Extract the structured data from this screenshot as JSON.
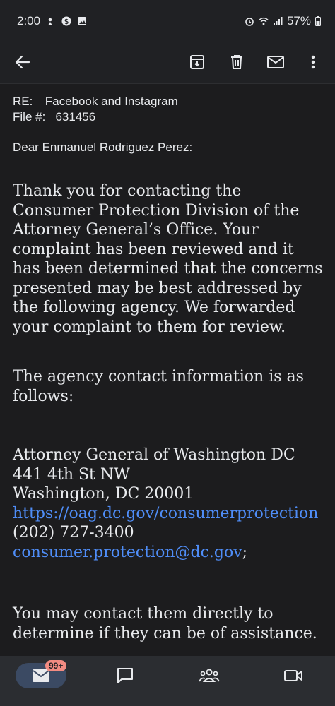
{
  "status_bar": {
    "time": "2:00",
    "battery": "57%",
    "icons": [
      "notification-icon",
      "s-app-icon",
      "image-icon",
      "alarm-icon",
      "wifi-icon",
      "signal-icon",
      "battery-icon"
    ]
  },
  "toolbar": {
    "icons": [
      "back-arrow-icon",
      "archive-icon",
      "delete-icon",
      "mark-unread-icon",
      "more-vert-icon"
    ]
  },
  "email": {
    "re_label": "RE:",
    "re_value": "Facebook and Instagram",
    "file_label": "File #:",
    "file_value": "631456",
    "greeting": "Dear Enmanuel Rodriguez Perez:",
    "para1": "Thank you for contacting the Consumer Protection Division of the Attorney General’s Office. Your complaint has been reviewed and it has been determined that the concerns presented may be best addressed by the following agency. We forwarded your complaint to them for review.",
    "para2": "The agency contact information is as follows:",
    "address": {
      "name": "Attorney General of Washington DC",
      "street": "441 4th St NW",
      "city": "Washington, DC 20001",
      "url": "https://oag.dc.gov/consumerprotection",
      "phone": "(202) 727-3400",
      "email": "consumer.protection@dc.gov",
      "email_suffix": ";"
    },
    "para3": "You may contact them directly to determine if they can be of assistance."
  },
  "bottom_nav": {
    "mail_badge": "99+",
    "icons": [
      "mail-icon",
      "chat-icon",
      "spaces-icon",
      "meet-icon"
    ]
  },
  "colors": {
    "background": "#1c1c1e",
    "link": "#4f8df7",
    "badge": "#f28b82",
    "nav_active": "#3b4a63"
  }
}
